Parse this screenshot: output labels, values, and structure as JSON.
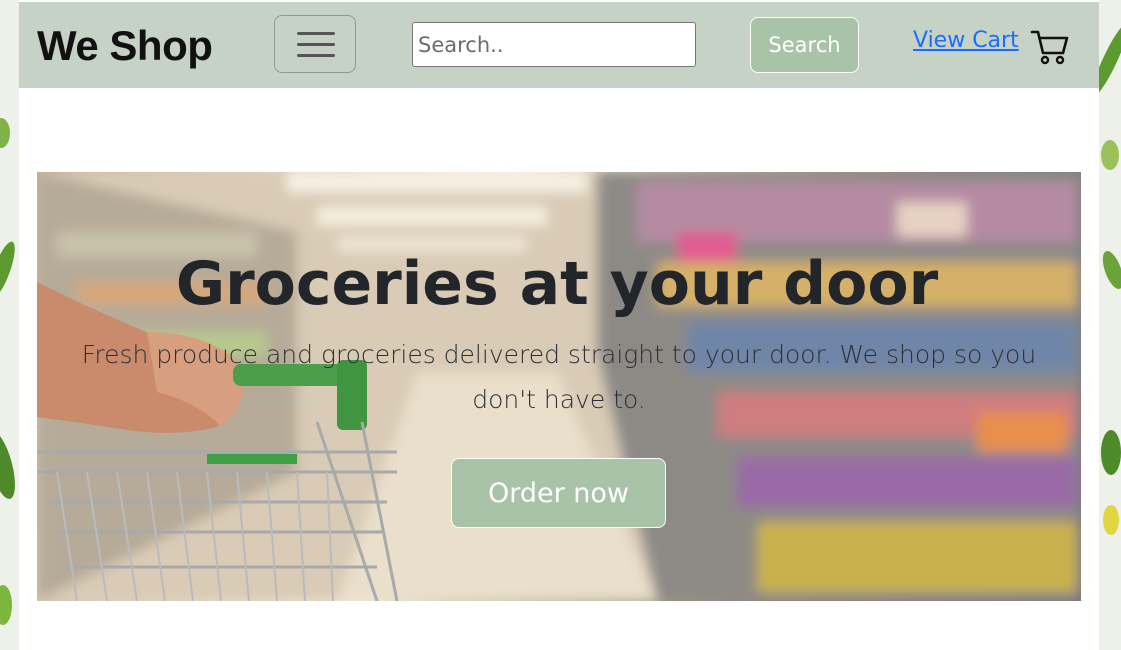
{
  "navbar": {
    "brand": "We Shop",
    "search_placeholder": "Search..",
    "search_button": "Search",
    "view_cart": "View Cart"
  },
  "hero": {
    "title": "Groceries at your door",
    "text": "Fresh produce and groceries delivered straight to your door. We shop so you don't have to.",
    "cta": "Order now"
  },
  "icons": {
    "menu": "hamburger-menu-icon",
    "cart": "shopping-cart-icon"
  },
  "colors": {
    "navbar_bg": "#c6d2c6",
    "button_bg": "#a8c3a8",
    "link": "#1a6dff"
  }
}
